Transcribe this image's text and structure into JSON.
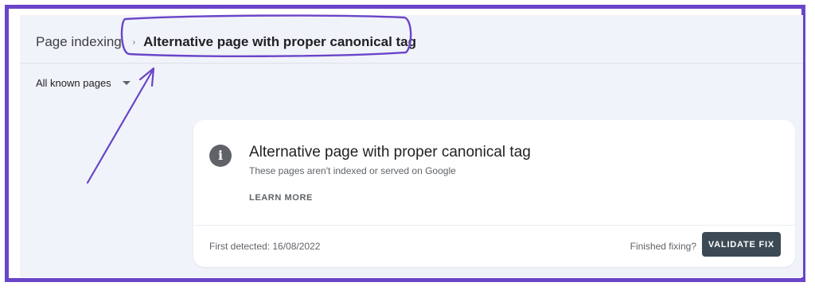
{
  "breadcrumb": {
    "root": "Page indexing",
    "separator": "›",
    "current": "Alternative page with proper canonical tag"
  },
  "filter": {
    "selected": "All known pages"
  },
  "card": {
    "icon": "info-icon",
    "icon_glyph": "i",
    "title": "Alternative page with proper canonical tag",
    "subtitle": "These pages aren't indexed or served on Google",
    "learn_more": "LEARN MORE",
    "first_detected": "First detected: 16/08/2022",
    "finished_prompt": "Finished fixing?",
    "validate_button": "VALIDATE FIX"
  },
  "colors": {
    "annotation": "#6a45c8",
    "panel_background": "#f1f3fa",
    "button": "#3c4a55"
  }
}
